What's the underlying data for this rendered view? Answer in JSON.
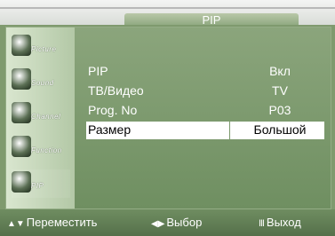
{
  "header": {
    "title": "PIP"
  },
  "sidebar": {
    "items": [
      {
        "label": "Picture",
        "icon": "picture-icon"
      },
      {
        "label": "Sound",
        "icon": "sound-icon"
      },
      {
        "label": "Channel",
        "icon": "channel-icon"
      },
      {
        "label": "Function",
        "icon": "function-icon"
      },
      {
        "label": "PIP",
        "icon": "pip-icon"
      }
    ]
  },
  "menu": {
    "rows": [
      {
        "label": "PIP",
        "value": "Вкл"
      },
      {
        "label": "ТВ/Видео",
        "value": "TV"
      },
      {
        "label": "Prog. No",
        "value": "P03"
      },
      {
        "label": "Размер",
        "value": "Большой"
      }
    ]
  },
  "footer": {
    "move": {
      "glyph": "▲▼",
      "label": "Переместить"
    },
    "select": {
      "glyph": "◀▶",
      "label": "Выбор"
    },
    "exit": {
      "glyph": "Ⅲ",
      "label": "Выход"
    }
  },
  "colors": {
    "panel": "#7f9a6e",
    "highlight": "#ffffff",
    "title_tab": "#9bb58b"
  }
}
